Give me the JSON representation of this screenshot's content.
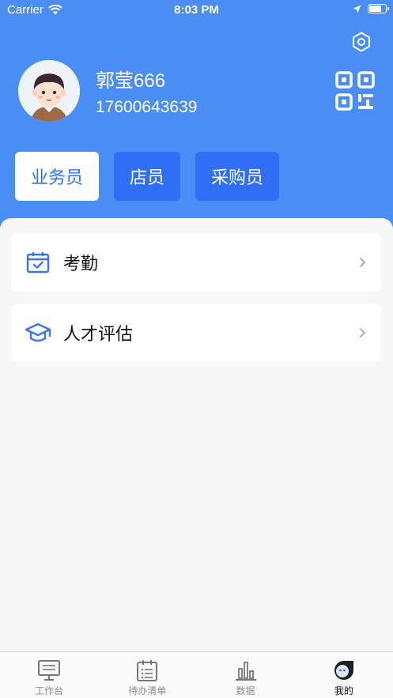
{
  "status_bar": {
    "carrier": "Carrier",
    "time": "8:03 PM"
  },
  "profile": {
    "name": "郭莹666",
    "phone": "17600643639"
  },
  "roles": [
    {
      "label": "业务员",
      "active": true
    },
    {
      "label": "店员",
      "active": false
    },
    {
      "label": "采购员",
      "active": false
    }
  ],
  "menu": [
    {
      "label": "考勤",
      "icon": "calendar-check-icon"
    },
    {
      "label": "人才评估",
      "icon": "graduation-cap-icon"
    }
  ],
  "tabs": [
    {
      "label": "工作台",
      "icon": "monitor-icon",
      "active": false
    },
    {
      "label": "待办清单",
      "icon": "todo-list-icon",
      "active": false
    },
    {
      "label": "数据",
      "icon": "bar-chart-icon",
      "active": false
    },
    {
      "label": "我的",
      "icon": "profile-face-icon",
      "active": true
    }
  ],
  "colors": {
    "header": "#4a8ef5",
    "accent": "#2f6ff5",
    "background": "#f7f7f7"
  }
}
